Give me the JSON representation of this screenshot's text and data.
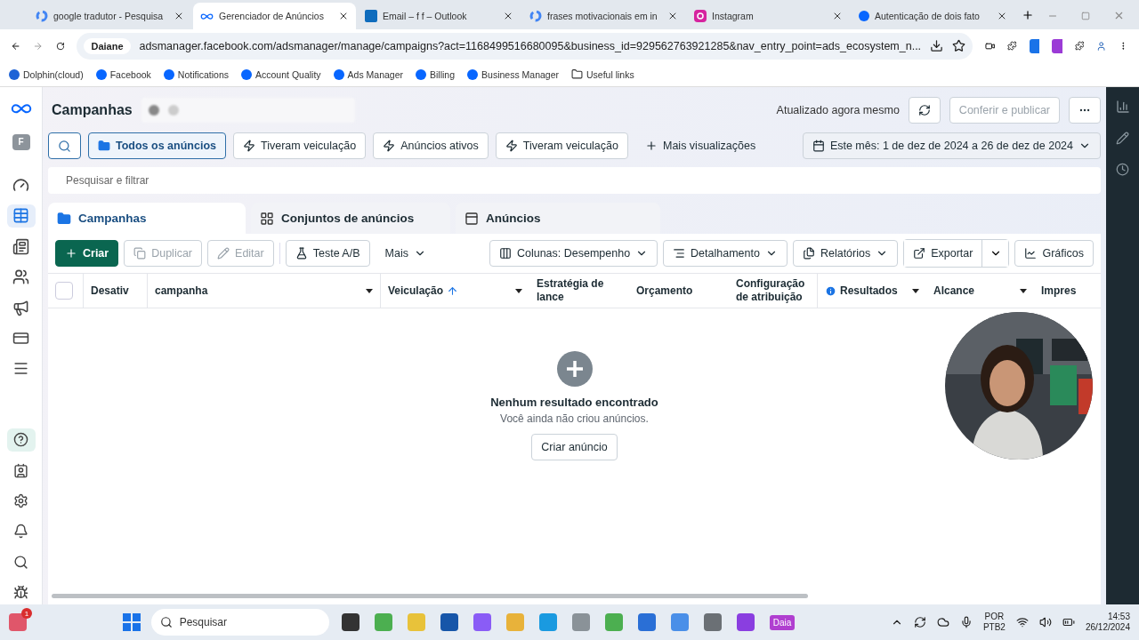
{
  "browser": {
    "tabs": [
      {
        "title": "google tradutor - Pesquisa",
        "selected": false
      },
      {
        "title": "Gerenciador de Anúncios",
        "selected": true
      },
      {
        "title": "Email – f f – Outlook",
        "selected": false
      },
      {
        "title": "frases motivacionais em in",
        "selected": false
      },
      {
        "title": "Instagram",
        "selected": false
      },
      {
        "title": "Autenticação de dois fato",
        "selected": false
      }
    ],
    "profile_chip": "Daiane",
    "url": "adsmanager.facebook.com/adsmanager/manage/campaigns?act=1168499516680095&business_id=929562763921285&nav_entry_point=ads_ecosystem_n...",
    "bookmarks": [
      {
        "label": "Dolphin(cloud)",
        "kind": "dolphin"
      },
      {
        "label": "Facebook",
        "kind": "facebook"
      },
      {
        "label": "Notifications",
        "kind": "facebook"
      },
      {
        "label": "Account Quality",
        "kind": "facebook"
      },
      {
        "label": "Ads Manager",
        "kind": "facebook"
      },
      {
        "label": "Billing",
        "kind": "facebook"
      },
      {
        "label": "Business Manager",
        "kind": "facebook"
      },
      {
        "label": "Useful links",
        "kind": "folder"
      }
    ]
  },
  "sidebar": {
    "avatar": "F",
    "items": [
      {
        "selected": false
      },
      {
        "selected": true
      },
      {
        "selected": false
      },
      {
        "selected": false
      },
      {
        "selected": false
      },
      {
        "selected": false
      },
      {
        "selected": false
      }
    ],
    "bottom_items": [
      {
        "selected": true
      },
      {
        "selected": false
      },
      {
        "selected": false
      },
      {
        "selected": false
      },
      {
        "selected": false
      },
      {
        "selected": false
      }
    ]
  },
  "header": {
    "title": "Campanhas",
    "updated": "Atualizado agora mesmo",
    "publish": "Conferir e publicar"
  },
  "views": [
    {
      "label": "Todos os anúncios",
      "selected": true
    },
    {
      "label": "Tiveram veiculação",
      "selected": false
    },
    {
      "label": "Anúncios ativos",
      "selected": false
    },
    {
      "label": "Tiveram veiculação",
      "selected": false
    }
  ],
  "more_views": "Mais visualizações",
  "date_range": "Este mês: 1 de dez de 2024 a 26 de dez de 2024",
  "search": {
    "placeholder": "Pesquisar e filtrar"
  },
  "level_tabs": [
    {
      "label": "Campanhas",
      "selected": true
    },
    {
      "label": "Conjuntos de anúncios",
      "selected": false
    },
    {
      "label": "Anúncios",
      "selected": false
    }
  ],
  "toolbar": [
    {
      "label": "Criar",
      "kind": "primary",
      "disabled": false
    },
    {
      "label": "Duplicar",
      "kind": "outline",
      "disabled": true
    },
    {
      "label": "Editar",
      "kind": "outline",
      "disabled": true
    },
    {
      "label": "Teste A/B",
      "kind": "outline",
      "disabled": false
    },
    {
      "label": "Mais",
      "kind": "plain",
      "disabled": false
    }
  ],
  "toolbar_right": [
    {
      "label": "Colunas: Desempenho",
      "dropdown": true,
      "split": false
    },
    {
      "label": "Detalhamento",
      "dropdown": true,
      "split": false
    },
    {
      "label": "Relatórios",
      "dropdown": true,
      "split": false
    },
    {
      "label": "Exportar",
      "dropdown": true,
      "split": true
    },
    {
      "label": "Gráficos",
      "dropdown": false,
      "split": false
    }
  ],
  "table": {
    "select_all": {
      "checked": false
    },
    "columns": [
      {
        "label": "Desativ",
        "menu": false,
        "sorted": false,
        "info": false
      },
      {
        "label": "campanha",
        "menu": true,
        "sorted": false,
        "info": false
      },
      {
        "label": "Veiculação",
        "menu": true,
        "sorted": true,
        "info": false
      },
      {
        "label": "Estratégia de lance",
        "menu": false,
        "sorted": false,
        "info": false
      },
      {
        "label": "Orçamento",
        "menu": false,
        "sorted": false,
        "info": false
      },
      {
        "label": "Configuração de atribuição",
        "menu": false,
        "sorted": false,
        "info": false
      },
      {
        "label": "Resultados",
        "menu": true,
        "sorted": false,
        "info": true
      },
      {
        "label": "Alcance",
        "menu": true,
        "sorted": false,
        "info": false
      },
      {
        "label": "Impres",
        "menu": false,
        "sorted": false,
        "info": false
      }
    ]
  },
  "empty_state": {
    "title": "Nenhum resultado encontrado",
    "message": "Você ainda não criou anúncios.",
    "action": "Criar anúncio"
  },
  "taskbar": {
    "notification_count": "1",
    "search_placeholder": "Pesquisar",
    "app_label": "Daia",
    "language": "POR",
    "layout": "PTB2",
    "time": "14:53",
    "date": "26/12/2024"
  }
}
